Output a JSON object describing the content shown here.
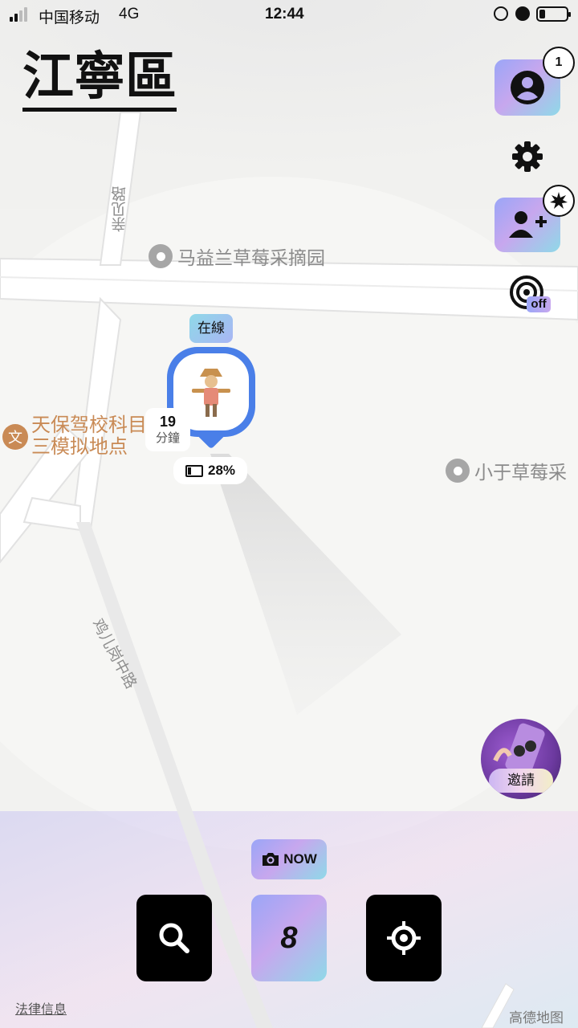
{
  "status_bar": {
    "carrier": "中国移动",
    "network": "4G",
    "time": "12:44"
  },
  "header": {
    "district": "江寧區"
  },
  "side_buttons": {
    "profile_badge": "1",
    "radar_state": "off"
  },
  "map": {
    "roads": [
      {
        "label": "亲见路"
      },
      {
        "label": "鸡儿岗中路"
      }
    ],
    "pois": [
      {
        "label": "马益兰草莓采摘园"
      },
      {
        "label": "天保驾校科目"
      },
      {
        "label": "三模拟地点"
      },
      {
        "label": "小于草莓采"
      }
    ],
    "attribution": "高德地图",
    "legal": "法律信息"
  },
  "user_marker": {
    "status": "在線",
    "minutes_value": "19",
    "minutes_unit": "分鐘",
    "battery": "28%",
    "battery_level": 0.28
  },
  "invite": {
    "label": "邀請"
  },
  "bottom_bar": {
    "now_label": "NOW",
    "center_count": "8"
  },
  "colors": {
    "marker_blue": "#4a7fe8",
    "poi_orange": "#c98a55"
  }
}
